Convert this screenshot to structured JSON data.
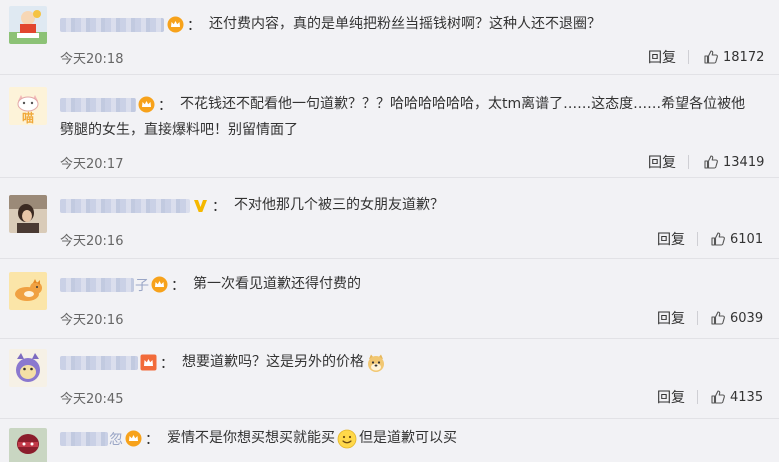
{
  "comments": [
    {
      "name_suffix": "",
      "text": "还付费内容，真的是单纯把粉丝当摇钱树啊？这种人还不退圈？",
      "time": "今天20:18",
      "reply_label": "回复",
      "likes": "18172"
    },
    {
      "name_suffix": "",
      "text_line1": "不花钱还不配看他一句道歉？？？哈哈哈哈哈哈，太tm离谱了……这态度……希望各位被他",
      "text_line2": "劈腿的女生，直接爆料吧！别留情面了",
      "time": "今天20:17",
      "reply_label": "回复",
      "likes": "13419"
    },
    {
      "name_suffix": "",
      "text": "不对他那几个被三的女朋友道歉？",
      "time": "今天20:16",
      "reply_label": "回复",
      "likes": "6101"
    },
    {
      "name_suffix": "子",
      "text": "第一次看见道歉还得付费的",
      "time": "今天20:16",
      "reply_label": "回复",
      "likes": "6039"
    },
    {
      "name_suffix": "",
      "text": "想要道歉吗？这是另外的价格",
      "time": "今天20:45",
      "reply_label": "回复",
      "likes": "4135"
    },
    {
      "name_suffix": "忽",
      "text_before_emoji": "爱情不是你想买想买就能买",
      "text_after_emoji": "但是道歉可以买"
    }
  ],
  "colon": "：",
  "icons": {
    "vip_crown": "crown-badge-icon",
    "verified": "verified-v-icon",
    "like": "thumbs-up-icon",
    "emoji_doge": "doge-emoji-icon",
    "emoji_smile": "smile-emoji-icon"
  },
  "colors": {
    "background": "#f2f2f5",
    "text": "#333333",
    "muted": "#666666",
    "crown": "#f7a21b",
    "verified": "#f5b800"
  }
}
